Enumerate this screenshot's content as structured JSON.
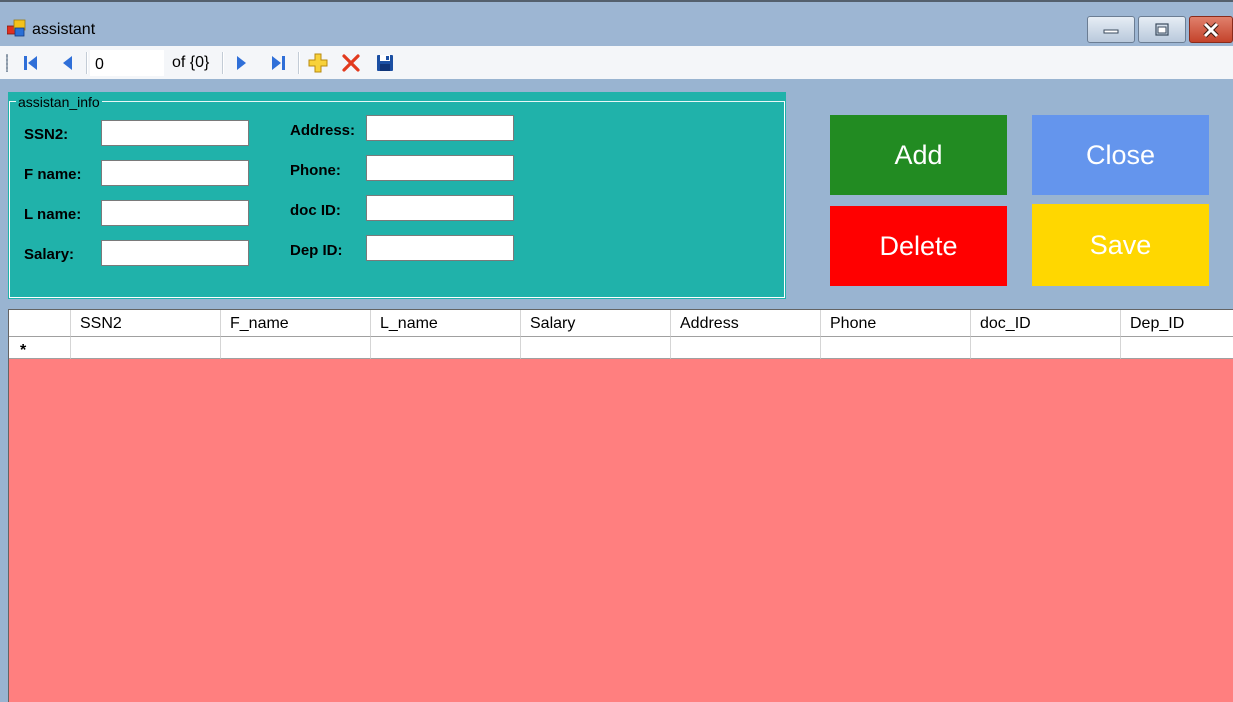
{
  "window": {
    "title": "assistant"
  },
  "navigator": {
    "position": "0",
    "count_label": "of {0}"
  },
  "groupbox": {
    "legend": "assistan_info",
    "fields_left": [
      {
        "label": "SSN2:",
        "value": ""
      },
      {
        "label": "F name:",
        "value": ""
      },
      {
        "label": "L name:",
        "value": ""
      },
      {
        "label": "Salary:",
        "value": ""
      }
    ],
    "fields_right": [
      {
        "label": "Address:",
        "value": ""
      },
      {
        "label": "Phone:",
        "value": ""
      },
      {
        "label": "doc ID:",
        "value": ""
      },
      {
        "label": "Dep ID:",
        "value": ""
      }
    ]
  },
  "actions": {
    "add": "Add",
    "close": "Close",
    "delete": "Delete",
    "save": "Save"
  },
  "colors": {
    "groupbox_bg": "#20b2aa",
    "add": "#228b22",
    "close": "#6495ed",
    "delete": "#ff0000",
    "save": "#ffd700",
    "grid_bg": "#ff7f7f"
  },
  "grid": {
    "columns": [
      "SSN2",
      "F_name",
      "L_name",
      "Salary",
      "Address",
      "Phone",
      "doc_ID",
      "Dep_ID"
    ],
    "new_row_marker": "*"
  },
  "icons": {
    "move_first": "move-first-icon",
    "move_previous": "move-previous-icon",
    "move_next": "move-next-icon",
    "move_last": "move-last-icon",
    "add_new": "add-new-icon",
    "delete": "delete-icon",
    "save": "save-icon"
  }
}
